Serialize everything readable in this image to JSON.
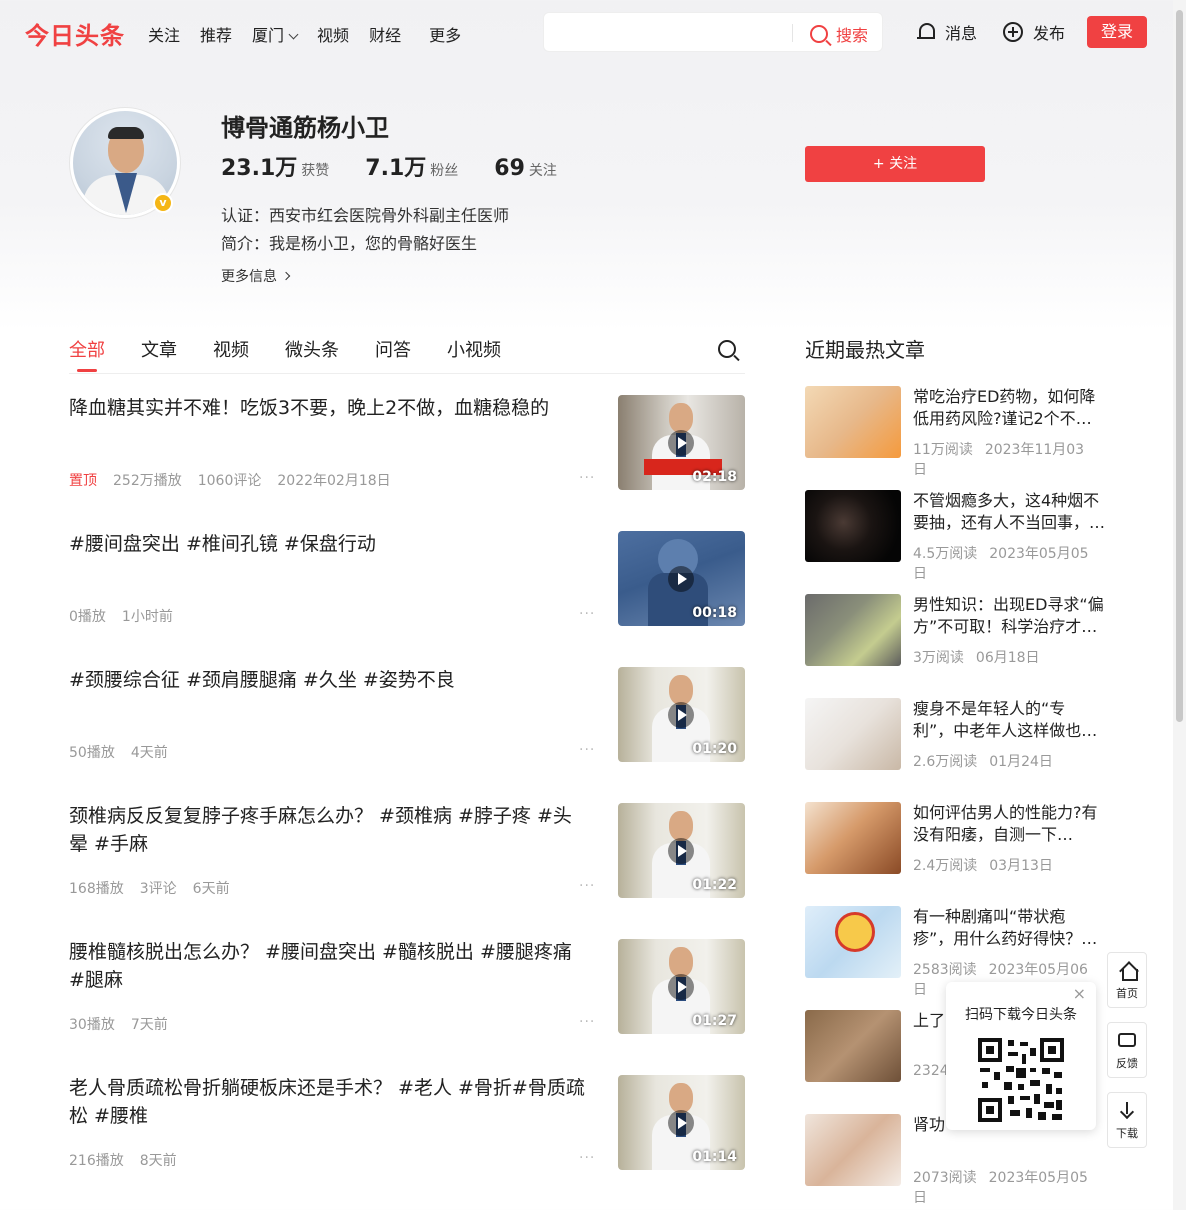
{
  "header": {
    "logo": "今日头条",
    "nav": [
      "关注",
      "推荐",
      "厦门",
      "视频",
      "财经",
      "更多"
    ],
    "search_placeholder": "",
    "search_label": "搜索",
    "messages_label": "消息",
    "publish_label": "发布",
    "login_label": "登录"
  },
  "profile": {
    "name": "博骨通筋杨小卫",
    "likes_num": "23.1万",
    "likes_label": "获赞",
    "fans_num": "7.1万",
    "fans_label": "粉丝",
    "follow_num": "69",
    "follow_label": "关注",
    "cert": "认证：西安市红会医院骨外科副主任医师",
    "intro": "简介：我是杨小卫，您的骨骼好医生",
    "more_info": "更多信息",
    "follow_button": "+ 关注",
    "verified_badge": "v"
  },
  "tabs": [
    "全部",
    "文章",
    "视频",
    "微头条",
    "问答",
    "小视频"
  ],
  "feed": [
    {
      "title": "降血糖其实并不难！吃饭3不要，晚上2不做，血糖稳稳的",
      "meta": [
        "置顶",
        "252万播放",
        "1060评论",
        "2022年02月18日"
      ],
      "duration": "02:18"
    },
    {
      "title": "#腰间盘突出 #椎间孔镜 #保盘行动",
      "meta": [
        "0播放",
        "1小时前"
      ],
      "duration": "00:18"
    },
    {
      "title": "#颈腰综合征 #颈肩腰腿痛 #久坐 #姿势不良",
      "meta": [
        "50播放",
        "4天前"
      ],
      "duration": "01:20"
    },
    {
      "title": "颈椎病反反复复脖子疼手麻怎么办？ #颈椎病 #脖子疼 #头晕 #手麻",
      "meta": [
        "168播放",
        "3评论",
        "6天前"
      ],
      "duration": "01:22"
    },
    {
      "title": "腰椎髓核脱出怎么办？ #腰间盘突出 #髓核脱出 #腰腿疼痛 #腿麻",
      "meta": [
        "30播放",
        "7天前"
      ],
      "duration": "01:27"
    },
    {
      "title": "老人骨质疏松骨折躺硬板床还是手术？ #老人 #骨折#骨质疏松 #腰椎",
      "meta": [
        "216播放",
        "8天前"
      ],
      "duration": "01:14"
    }
  ],
  "hot": {
    "title": "近期最热文章",
    "items": [
      {
        "title": "常吃治疗ED药物，如何降低用药风险?谨记2个不要…",
        "reads": "11万阅读",
        "date": "2023年11月03日"
      },
      {
        "title": "不管烟瘾多大，这4种烟不要抽，还有人不当回事，…",
        "reads": "4.5万阅读",
        "date": "2023年05月05日"
      },
      {
        "title": "男性知识：出现ED寻求“偏方”不可取！科学治疗才…",
        "reads": "3万阅读",
        "date": "06月18日"
      },
      {
        "title": "瘦身不是年轻人的“专利”，中老年人这样做也能拥…",
        "reads": "2.6万阅读",
        "date": "01月24日"
      },
      {
        "title": "如何评估男人的性能力?有没有阳痿，自测一下…",
        "reads": "2.4万阅读",
        "date": "03月13日"
      },
      {
        "title": "有一种剧痛叫“带状疱疹”，用什么药好得快？提醒：…",
        "reads": "2583阅读",
        "date": "2023年05月06日"
      },
      {
        "title": "上了",
        "reads": "2324",
        "date": ""
      },
      {
        "title": "肾功",
        "reads": "2073阅读",
        "date": "2023年05月05日"
      }
    ]
  },
  "qr_popup": {
    "text": "扫码下载今日头条",
    "close": "×"
  },
  "float_tools": [
    "首页",
    "反馈",
    "下载"
  ],
  "colors": {
    "brand": "#f04142",
    "muted": "#999999",
    "text": "#222222"
  },
  "icons": [
    "search-icon",
    "bell-icon",
    "plus-circle-icon",
    "chevron-down-icon",
    "chevron-right-icon",
    "play-icon",
    "more-dots-icon",
    "home-icon",
    "feedback-icon",
    "download-icon",
    "close-icon",
    "qr-code-icon"
  ]
}
